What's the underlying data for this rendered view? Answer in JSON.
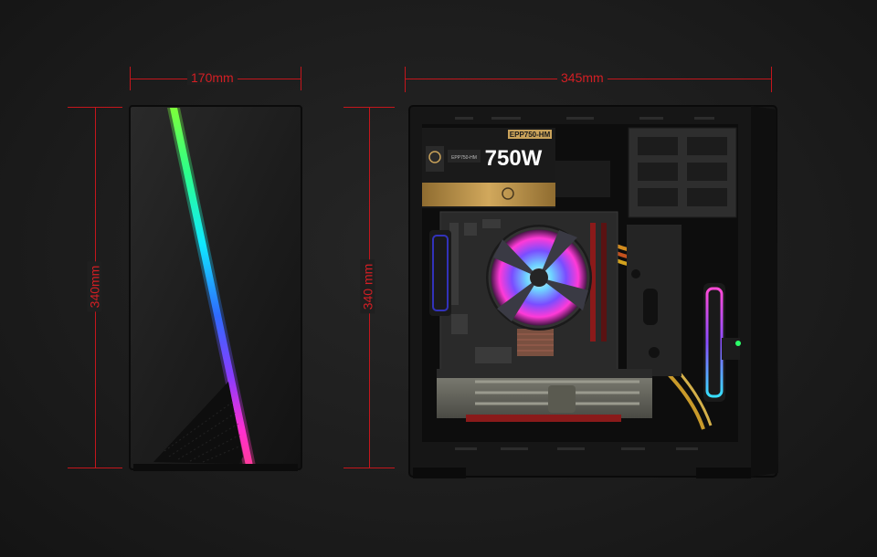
{
  "dimensions": {
    "front_width": "170mm",
    "front_height": "340mm",
    "side_width": "345mm",
    "side_height": "340 mm"
  },
  "psu": {
    "model": "EPP750-HM",
    "model_small": "EPP750-HM",
    "wattage": "750W"
  },
  "colors": {
    "dimension_red": "#c4161c",
    "case_black": "#151515",
    "psu_gold": "#b8924a"
  }
}
